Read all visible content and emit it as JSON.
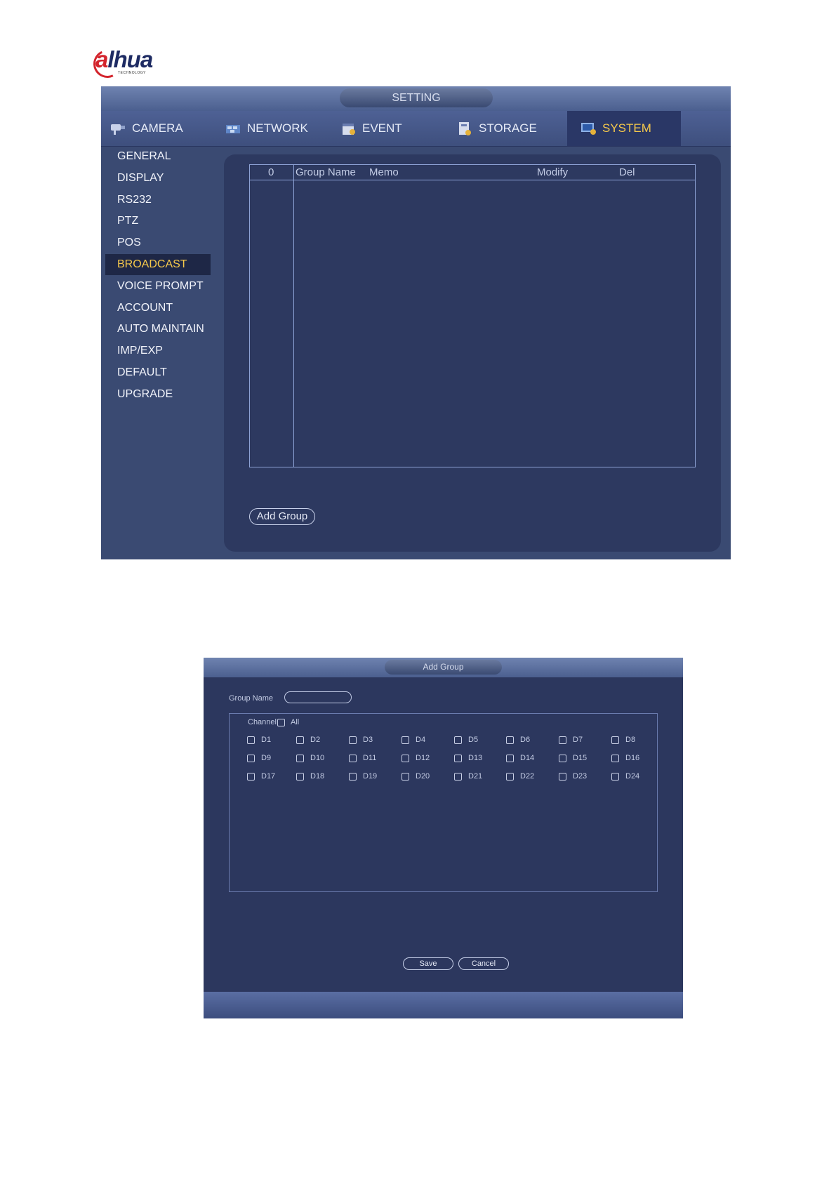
{
  "logo": {
    "brand_a": "a",
    "brand_rest": "lhua",
    "tagline": "TECHNOLOGY"
  },
  "settings_window": {
    "title": "SETTING",
    "tabs": [
      {
        "label": "CAMERA",
        "icon": "camera-icon"
      },
      {
        "label": "NETWORK",
        "icon": "network-icon"
      },
      {
        "label": "EVENT",
        "icon": "event-icon"
      },
      {
        "label": "STORAGE",
        "icon": "storage-icon"
      },
      {
        "label": "SYSTEM",
        "icon": "system-icon",
        "active": true
      }
    ],
    "sidebar": [
      "GENERAL",
      "DISPLAY",
      "RS232",
      "PTZ",
      "POS",
      "BROADCAST",
      "VOICE PROMPT",
      "ACCOUNT",
      "AUTO MAINTAIN",
      "IMP/EXP",
      "DEFAULT",
      "UPGRADE"
    ],
    "sidebar_active": "BROADCAST",
    "table": {
      "columns": [
        "0",
        "Group Name",
        "Memo",
        "Modify",
        "Del"
      ],
      "rows": []
    },
    "add_group_label": "Add Group"
  },
  "add_group_dialog": {
    "title": "Add Group",
    "group_name_label": "Group Name",
    "group_name_value": "",
    "channel_label": "Channel",
    "all_label": "All",
    "channels": [
      "D1",
      "D2",
      "D3",
      "D4",
      "D5",
      "D6",
      "D7",
      "D8",
      "D9",
      "D10",
      "D11",
      "D12",
      "D13",
      "D14",
      "D15",
      "D16",
      "D17",
      "D18",
      "D19",
      "D20",
      "D21",
      "D22",
      "D23",
      "D24"
    ],
    "save_label": "Save",
    "cancel_label": "Cancel"
  },
  "colors": {
    "accent": "#f6c94b",
    "panel": "#2d3960",
    "frame": "#3a4a72",
    "brand_red": "#d3242c",
    "brand_blue": "#1e2b63"
  }
}
